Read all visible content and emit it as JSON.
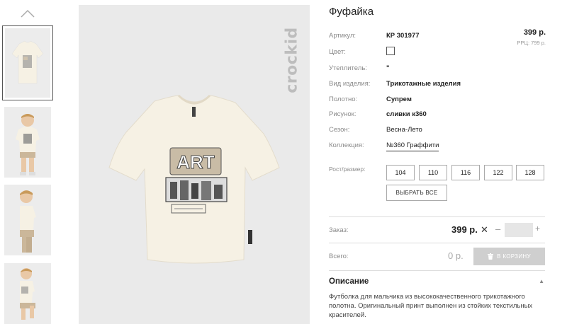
{
  "gallery": {
    "thumbnails": [
      "Флатлей футболки",
      "Мальчик анфас",
      "Мальчик в профиль",
      "Мальчик сидит"
    ],
    "brand_watermark": "crockid"
  },
  "product": {
    "title": "Фуфайка",
    "price": "399 р.",
    "rrp": "РРЦ: 799 р.",
    "properties": [
      {
        "label": "Артикул:",
        "value": "КР 301977"
      },
      {
        "label": "Цвет:",
        "value": ""
      },
      {
        "label": "Утеплитель:",
        "value": "\""
      },
      {
        "label": "Вид изделия:",
        "value": "Трикотажные изделия"
      },
      {
        "label": "Полотно:",
        "value": "Супрем"
      },
      {
        "label": "Рисунок:",
        "value": "сливки к360"
      },
      {
        "label": "Сезон:",
        "value": "Весна-Лето"
      },
      {
        "label": "Коллекция:",
        "value": "№360 Граффити"
      }
    ],
    "color_swatch": "#ffffff",
    "print_text": "ART"
  },
  "sizes": {
    "label": "Рост/размер:",
    "options": [
      "104",
      "110",
      "116",
      "122",
      "128"
    ],
    "select_all": "ВЫБРАТЬ ВСЕ"
  },
  "order": {
    "label": "Заказ:",
    "price": "399 р.",
    "times": "✕",
    "minus": "–",
    "plus": "+",
    "quantity": ""
  },
  "total": {
    "label": "Всего:",
    "value": "0 р.",
    "cart_button": "В КОРЗИНУ",
    "cart_icon": "trash-icon"
  },
  "description": {
    "title": "Описание",
    "text": "Футболка для мальчика из высококачественного трикотажного полотна. Оригинальный принт выполнен из стойких текстильных красителей."
  },
  "colors": {
    "tee": "#f6f1e4",
    "bg": "#eaeaea",
    "button_disabled": "#cfcfcf"
  }
}
